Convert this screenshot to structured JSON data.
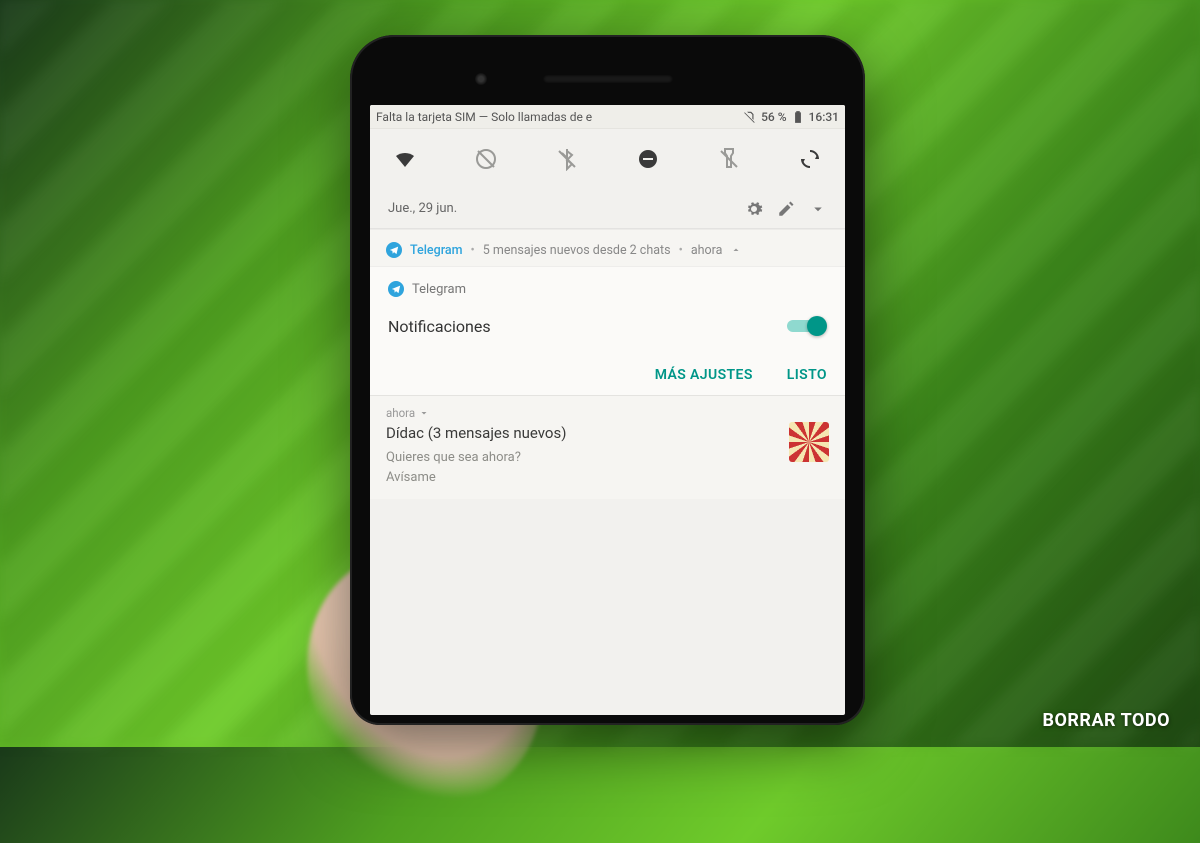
{
  "statusbar": {
    "sim_text": "Falta la tarjeta SIM — Solo llamadas de e",
    "battery_pct": "56 %",
    "time": "16:31"
  },
  "quicksettings": {
    "icons": [
      "wifi",
      "data-saver-off",
      "bluetooth-off",
      "dnd",
      "flashlight-off",
      "auto-rotate"
    ]
  },
  "date": "Jue., 29 jun.",
  "notif_header": {
    "app": "Telegram",
    "summary": "5 mensajes nuevos desde 2 chats",
    "time": "ahora"
  },
  "settings_card": {
    "app": "Telegram",
    "row_label": "Notificaciones",
    "toggle_on": true,
    "more_label": "MÁS AJUSTES",
    "done_label": "LISTO"
  },
  "notif2": {
    "time": "ahora",
    "title": "Dídac (3 mensajes nuevos)",
    "lines": [
      "Quieres que sea ahora?",
      "Avísame"
    ]
  },
  "clear_all": "BORRAR TODO"
}
